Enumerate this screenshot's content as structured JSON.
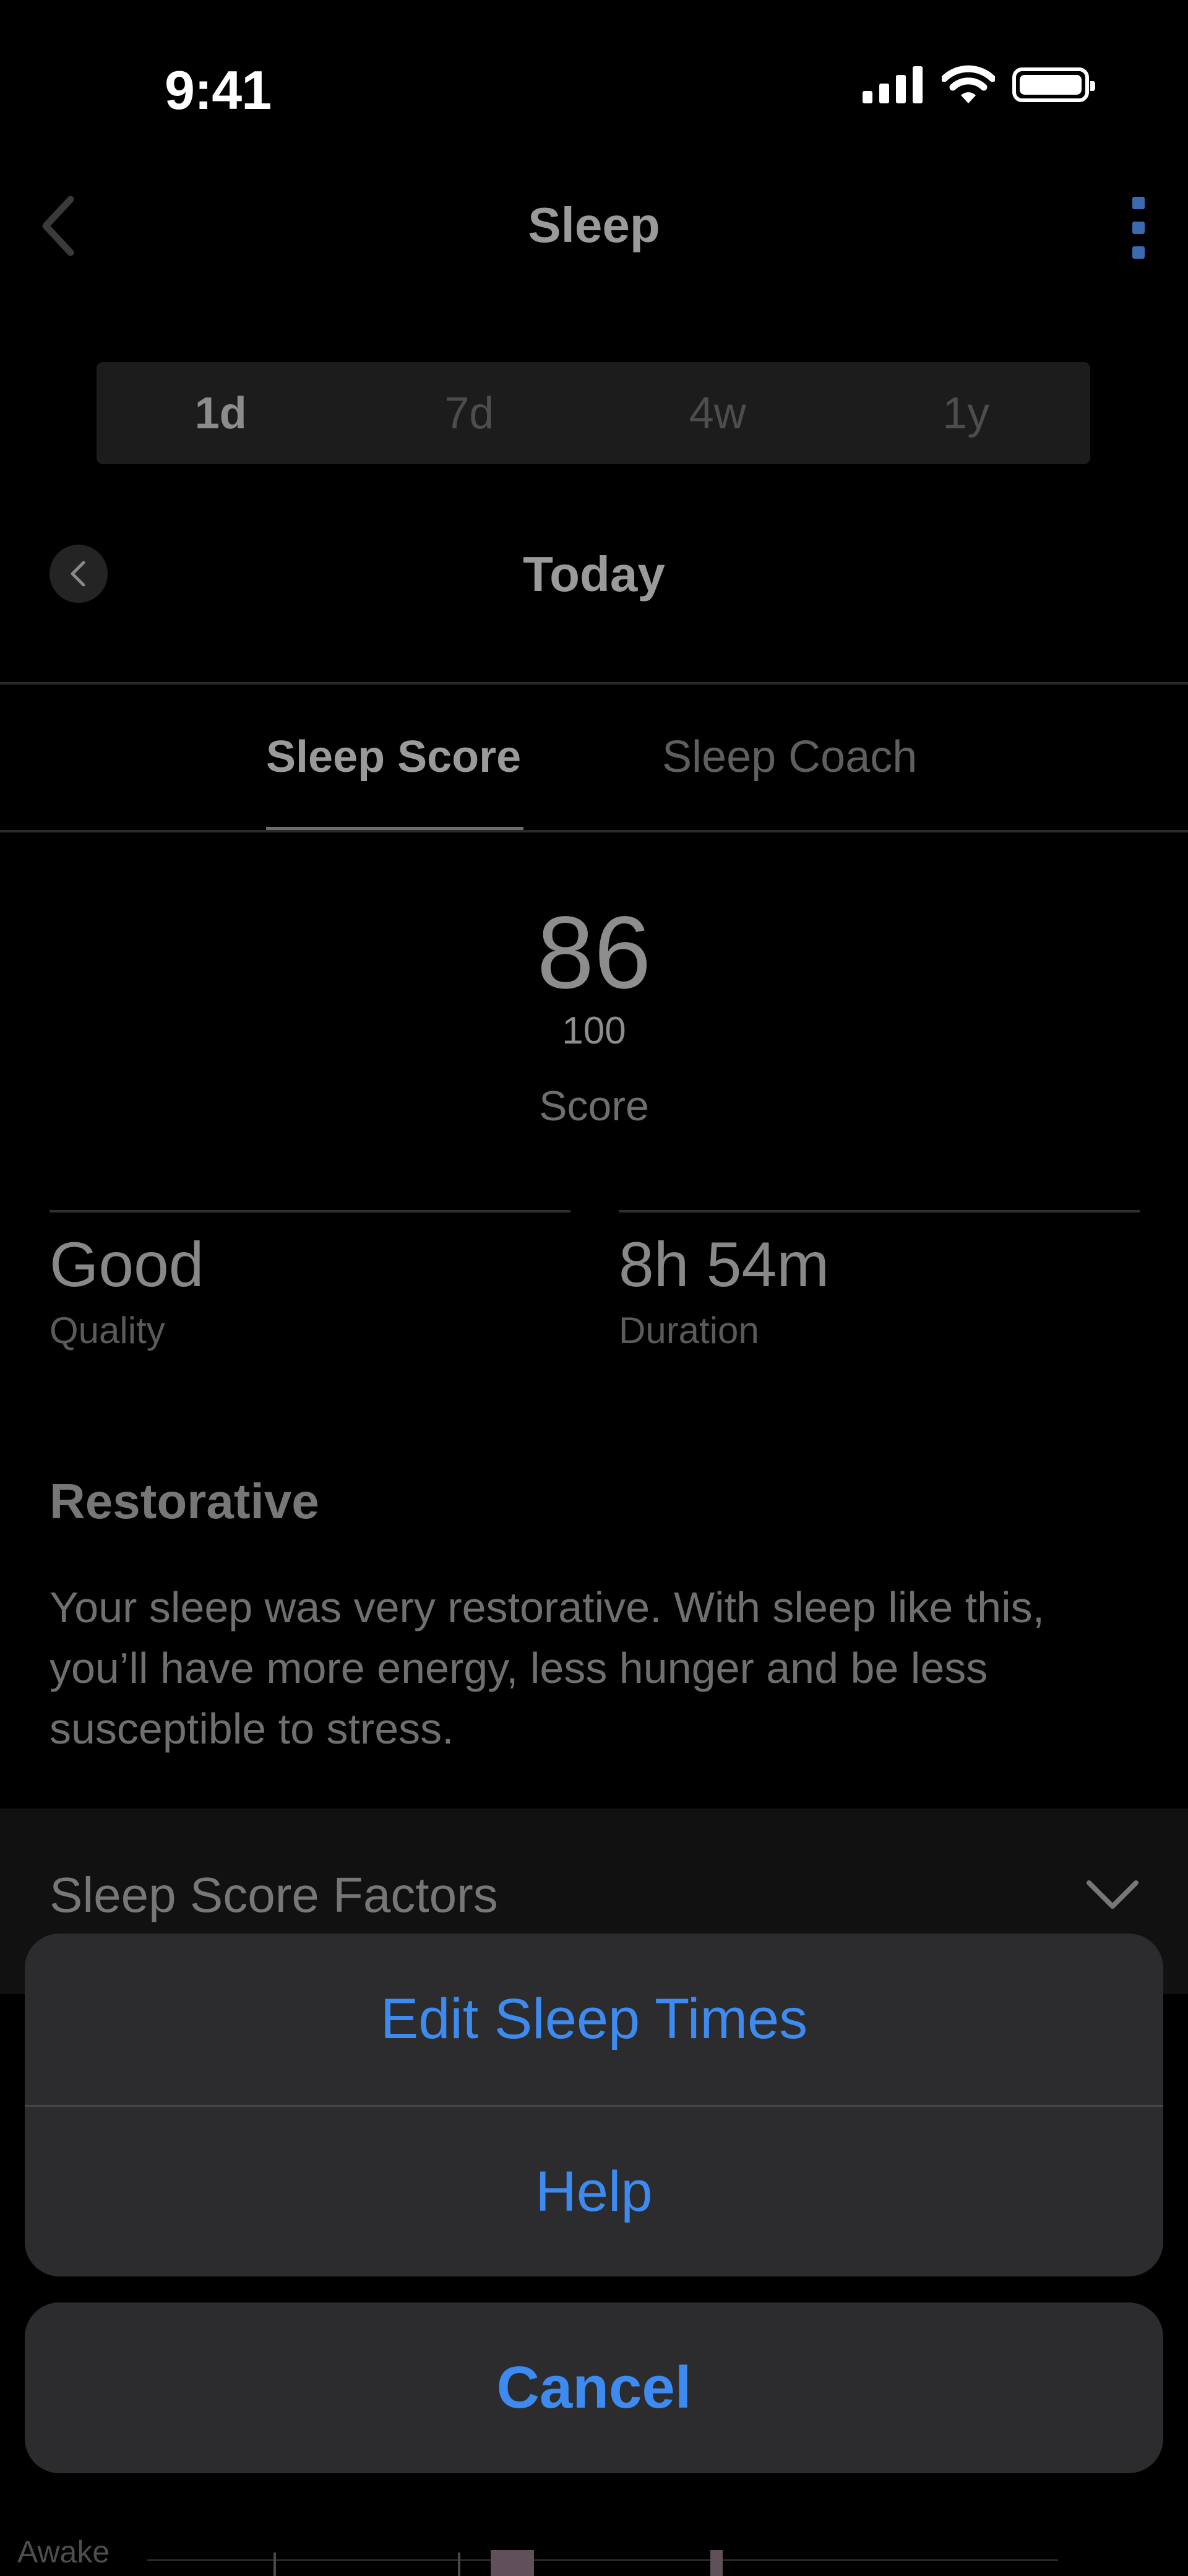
{
  "status_bar": {
    "time": "9:41"
  },
  "nav": {
    "title": "Sleep"
  },
  "range_selector": {
    "options": [
      "1d",
      "7d",
      "4w",
      "1y"
    ],
    "selected": "1d"
  },
  "date_nav": {
    "label": "Today"
  },
  "tabs": [
    {
      "label": "Sleep Score",
      "active": true
    },
    {
      "label": "Sleep Coach",
      "active": false
    }
  ],
  "score": {
    "value": "86",
    "max": "100",
    "label": "Score"
  },
  "stats": [
    {
      "value": "Good",
      "label": "Quality"
    },
    {
      "value": "8h 54m",
      "label": "Duration"
    }
  ],
  "section": {
    "heading": "Restorative",
    "body": "Your sleep was very restorative. With sleep like this, you’ll have more energy, less hunger and be less susceptible to stress."
  },
  "factors": {
    "label": "Sleep Score Factors"
  },
  "action_sheet": {
    "edit_label": "Edit Sleep Times",
    "help_label": "Help",
    "cancel_label": "Cancel"
  },
  "chart_peek": {
    "label": "Awake"
  },
  "colors": {
    "accent": "#3d8bf0",
    "menu_dots": "#3a6bb0",
    "sheet_bg": "#2c2c2e"
  }
}
